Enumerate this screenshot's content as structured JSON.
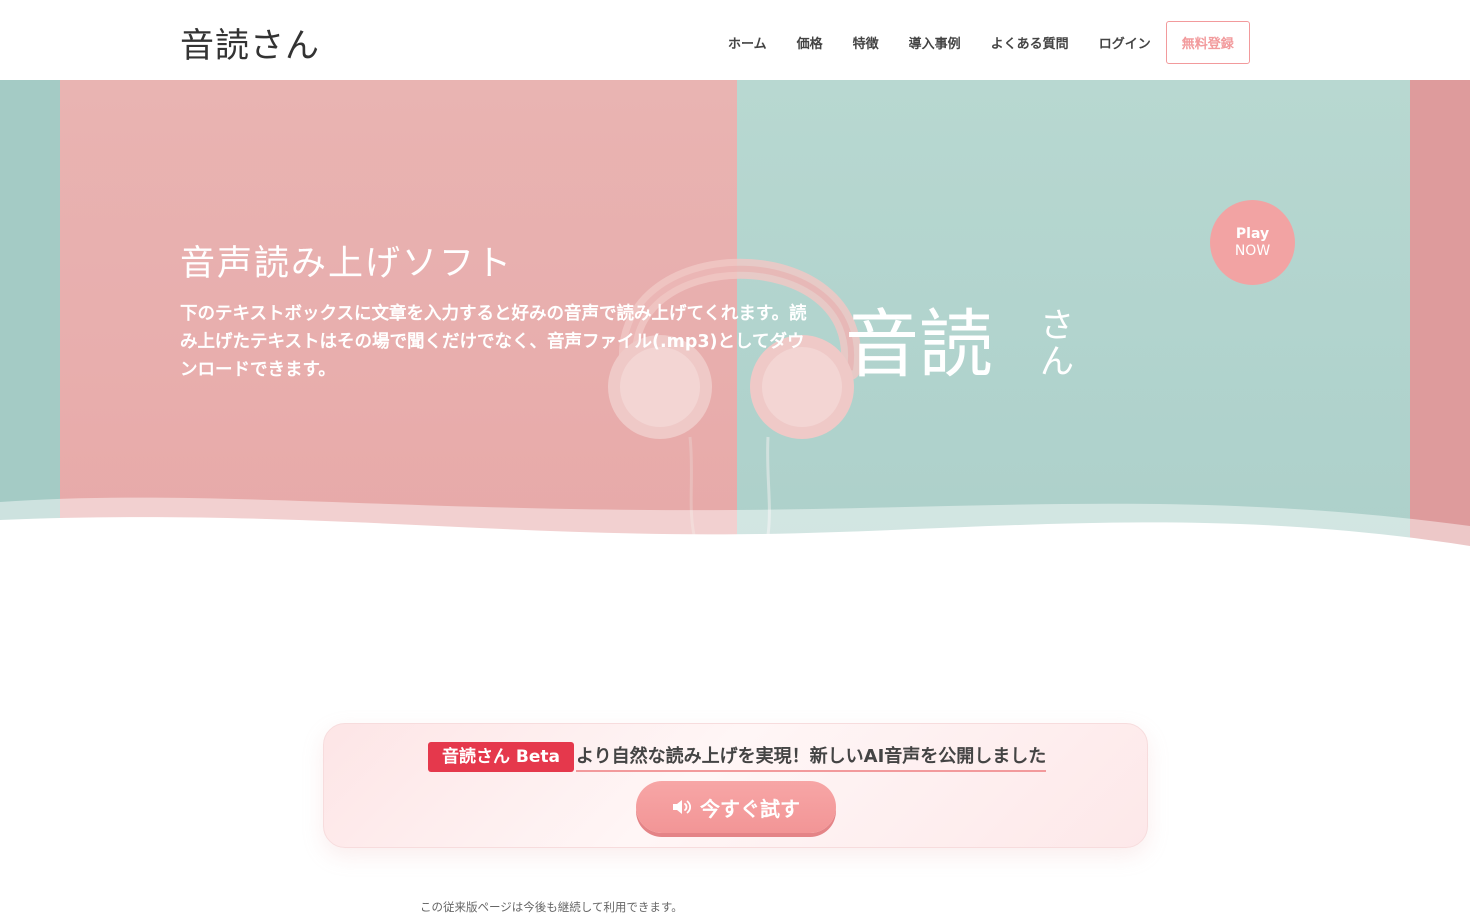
{
  "header": {
    "logo": "音読さん",
    "nav": [
      "ホーム",
      "価格",
      "特徴",
      "導入事例",
      "よくある質問",
      "ログイン"
    ],
    "signup": "無料登録"
  },
  "hero": {
    "title": "音声読み上げソフト",
    "description": "下のテキストボックスに文章を入力すると好みの音声で読み上げてくれます。読み上げたテキストはその場で聞くだけでなく、音声ファイル(.mp3)としてダウンロードできます。",
    "brand_big": "音読",
    "brand_small": "さん",
    "play_top": "Play",
    "play_bottom": "NOW"
  },
  "announcement": {
    "badge": "音読さん Beta",
    "link": "より自然な読み上げを実現！新しいAI音声を公開しました",
    "button": "今すぐ試す",
    "button_icon": "speaker-icon"
  },
  "footnote": "この従来版ページは今後も継続して利用できます。",
  "colors": {
    "pink": "#e7a9a8",
    "mint": "#a8cec7",
    "accent": "#f29a9c",
    "badge": "#e5384c"
  }
}
